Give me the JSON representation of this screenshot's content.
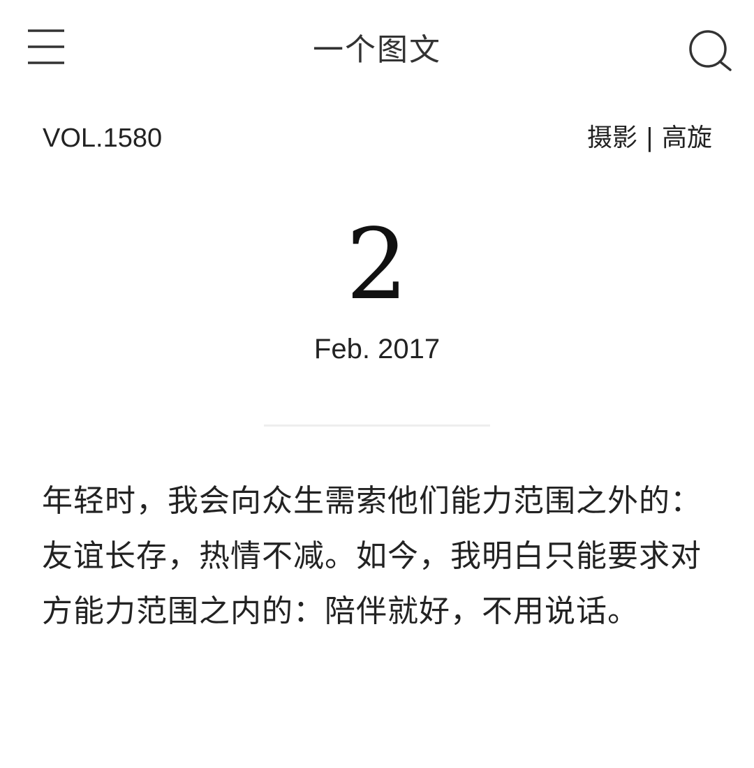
{
  "header": {
    "title": "一个图文",
    "menu_icon": "hamburger-menu-icon",
    "search_icon": "search-icon"
  },
  "meta": {
    "volume": "VOL.1580",
    "credit": "摄影 | 高旋"
  },
  "date": {
    "day": "2",
    "month_year": "Feb. 2017"
  },
  "article": {
    "text": "年轻时，我会向众生需索他们能力范围之外的：友谊长存，热情不减。如今，我明白只能要求对方能力范围之内的：陪伴就好，不用说话。"
  },
  "colors": {
    "text": "#222222",
    "divider": "#eeeeee",
    "background": "#ffffff"
  }
}
